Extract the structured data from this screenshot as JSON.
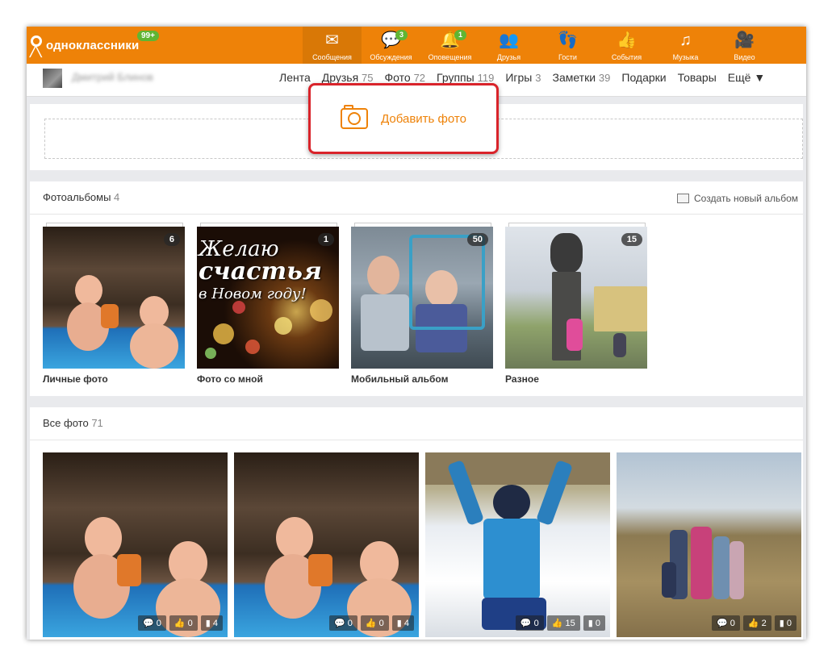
{
  "header": {
    "logo_text": "одноклассники",
    "logo_badge": "99+",
    "nav": [
      {
        "label": "Сообщения",
        "icon": "envelope-icon",
        "glyph": "✉",
        "badge": ""
      },
      {
        "label": "Обсуждения",
        "icon": "chat-bubbles-icon",
        "glyph": "💬",
        "badge": "3"
      },
      {
        "label": "Оповещения",
        "icon": "bell-icon",
        "glyph": "🔔",
        "badge": "1"
      },
      {
        "label": "Друзья",
        "icon": "friends-icon",
        "glyph": "👥",
        "badge": ""
      },
      {
        "label": "Гости",
        "icon": "footprints-icon",
        "glyph": "👣",
        "badge": ""
      },
      {
        "label": "События",
        "icon": "events-like-icon",
        "glyph": "👍",
        "badge": ""
      },
      {
        "label": "Музыка",
        "icon": "music-note-icon",
        "glyph": "♫",
        "badge": ""
      },
      {
        "label": "Видео",
        "icon": "video-camera-icon",
        "glyph": "🎥",
        "badge": ""
      }
    ]
  },
  "profile": {
    "user_name": "Дмитрий Блинов"
  },
  "tabs": [
    {
      "label": "Лента",
      "count": ""
    },
    {
      "label": "Друзья",
      "count": "75"
    },
    {
      "label": "Фото",
      "count": "72"
    },
    {
      "label": "Группы",
      "count": "119"
    },
    {
      "label": "Игры",
      "count": "3"
    },
    {
      "label": "Заметки",
      "count": "39"
    },
    {
      "label": "Подарки",
      "count": ""
    },
    {
      "label": "Товары",
      "count": ""
    },
    {
      "label": "Ещё ▼",
      "count": ""
    }
  ],
  "upload": {
    "label": "Добавить фото"
  },
  "albums_section": {
    "title": "Фотоальбомы",
    "count": "4",
    "create_label": "Создать новый альбом",
    "albums": [
      {
        "name": "Личные фото",
        "count": "6"
      },
      {
        "name": "Фото со мной",
        "count": "1",
        "overlay_line1": "Желаю",
        "overlay_line2": "счастья",
        "overlay_line3": "в Новом году!"
      },
      {
        "name": "Мобильный альбом",
        "count": "50"
      },
      {
        "name": "Разное",
        "count": "15"
      }
    ]
  },
  "all_photos": {
    "title": "Все фото",
    "count": "71",
    "photos": [
      {
        "comments": "0",
        "likes": "0",
        "views": "4"
      },
      {
        "comments": "0",
        "likes": "0",
        "views": "4"
      },
      {
        "comments": "0",
        "likes": "15",
        "views": "0"
      },
      {
        "comments": "0",
        "likes": "2",
        "views": "0"
      }
    ]
  },
  "colors": {
    "brand_orange": "#ee8208",
    "highlight_red": "#d9232a",
    "badge_green": "#5fb533"
  }
}
